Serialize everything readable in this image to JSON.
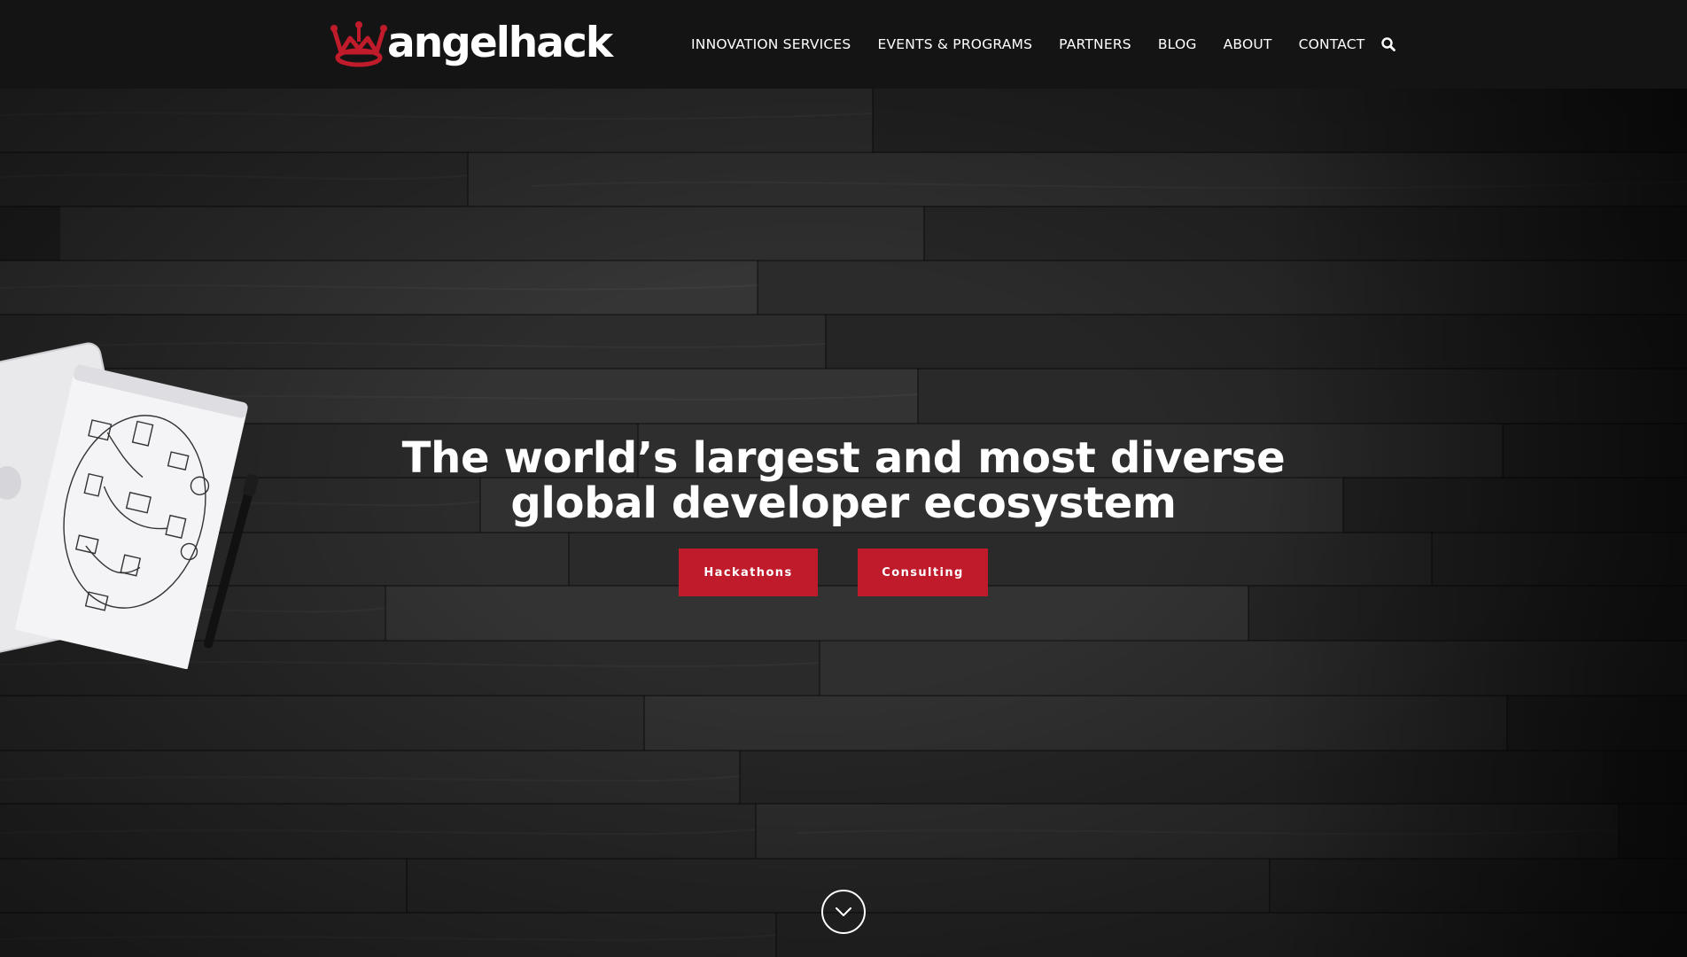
{
  "brand": {
    "name": "angelhack",
    "accent_color": "#c01b2b",
    "header_bg": "#141414"
  },
  "nav": {
    "items": [
      {
        "label": "INNOVATION SERVICES"
      },
      {
        "label": "EVENTS & PROGRAMS"
      },
      {
        "label": "PARTNERS"
      },
      {
        "label": "BLOG"
      },
      {
        "label": "ABOUT"
      },
      {
        "label": "CONTACT"
      }
    ],
    "search_icon": "search-icon"
  },
  "hero": {
    "title_line1": "The world’s largest and most diverse",
    "title_line2": "global developer ecosystem",
    "buttons": [
      {
        "label": "Hackathons"
      },
      {
        "label": "Consulting"
      }
    ],
    "background": "dark-wood-planks",
    "scroll_icon": "chevron-down-icon"
  }
}
